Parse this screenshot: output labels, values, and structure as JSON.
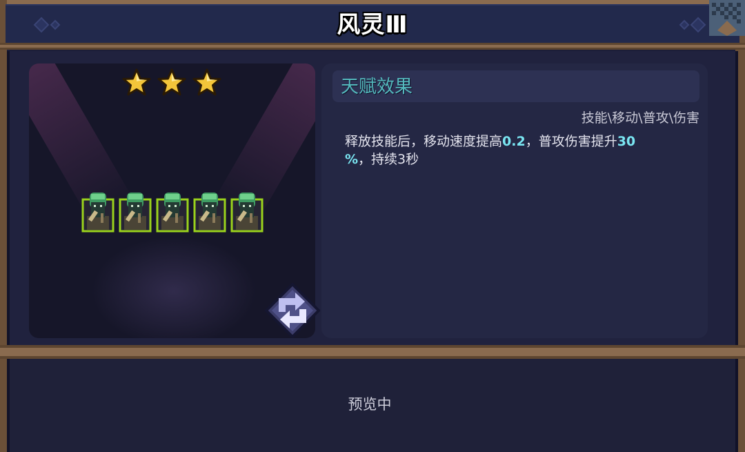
{
  "title": "风灵Ⅲ",
  "stars": {
    "count": 3,
    "color": "#f3c53a"
  },
  "units": {
    "count": 5,
    "border_color": "#9ad21c"
  },
  "talent": {
    "header": "天赋效果",
    "tags": "技能\\移动\\普攻\\伤害",
    "desc": {
      "part1": "释放技能后，移动速度提高",
      "value1": "0.2",
      "part2": "，普攻伤害提升",
      "value2": "30",
      "part3": "%",
      "part4": "，持续3秒"
    }
  },
  "icons": {
    "refresh": "refresh-icon",
    "star": "star-icon"
  },
  "footer": {
    "status": "预览中"
  },
  "colors": {
    "highlight": "#7ae6f2",
    "header_text": "#54b9bd"
  }
}
